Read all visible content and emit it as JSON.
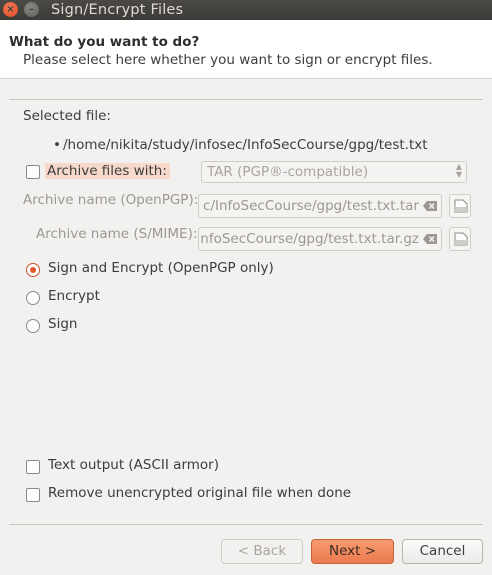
{
  "window": {
    "title": "Sign/Encrypt Files"
  },
  "header": {
    "question": "What do you want to do?",
    "instruction": "Please select here whether you want to sign or encrypt files."
  },
  "selected_file": {
    "label": "Selected file:",
    "path": "/home/nikita/study/infosec/InfoSecCourse/gpg/test.txt"
  },
  "archive": {
    "checkbox_label": "Archive files with:",
    "checked": false,
    "format_selected": "TAR (PGP®-compatible)",
    "openpgp_label": "Archive name (OpenPGP):",
    "openpgp_value": "c/InfoSecCourse/gpg/test.txt.tar",
    "smime_label": "Archive name (S/MIME):",
    "smime_value": "nfoSecCourse/gpg/test.txt.tar.gz"
  },
  "operations": [
    {
      "label": "Sign and Encrypt (OpenPGP only)",
      "selected": true
    },
    {
      "label": "Encrypt",
      "selected": false
    },
    {
      "label": "Sign",
      "selected": false
    }
  ],
  "options": {
    "text_output": "Text output (ASCII armor)",
    "remove_original": "Remove unencrypted original file when done"
  },
  "buttons": {
    "back": "< Back",
    "next": "Next >",
    "cancel": "Cancel"
  },
  "colors": {
    "accent": "#ec7a4f",
    "titlebar": "#3c3b37",
    "highlight": "#f7d9cc"
  }
}
